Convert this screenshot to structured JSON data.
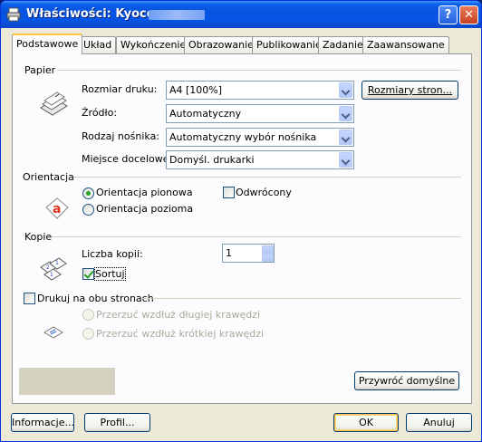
{
  "window": {
    "title": "Właściwości: Kyocera"
  },
  "titlebar": {
    "help": "?",
    "close": "✕"
  },
  "tabs": [
    "Podstawowe",
    "Układ",
    "Wykończenie",
    "Obrazowanie",
    "Publikowanie",
    "Zadanie",
    "Zaawansowane"
  ],
  "paper": {
    "group": "Papier",
    "size_label": "Rozmiar druku:",
    "size_value": "A4  [100%]",
    "page_sizes_button": "Rozmiary stron...",
    "source_label": "Źródło:",
    "source_value": "Automatyczny",
    "media_label": "Rodzaj nośnika:",
    "media_value": "Automatyczny",
    "output_label": "Miejsce docelowe:",
    "output_value": "Automatyczny wybór nośnika",
    "dest_value": "Domyśl. drukarki"
  },
  "orientation": {
    "group": "Orientacja",
    "portrait": "Orientacja pionowa",
    "landscape": "Orientacja pozioma",
    "rotated": "Odwrócony"
  },
  "copies": {
    "group": "Kopie",
    "count_label": "Liczba kopii:",
    "count_value": "1",
    "collate": "Sortuj"
  },
  "duplex": {
    "label": "Drukuj na obu stronach",
    "long_edge": "Przerzuć wzdłuż długiej krawędzi",
    "short_edge": "Przerzuć wzdłuż krótkiej krawędzi"
  },
  "buttons": {
    "restore": "Przywróć domyślne",
    "info": "Informacje...",
    "profile": "Profil...",
    "ok": "OK",
    "cancel": "Anuluj"
  }
}
